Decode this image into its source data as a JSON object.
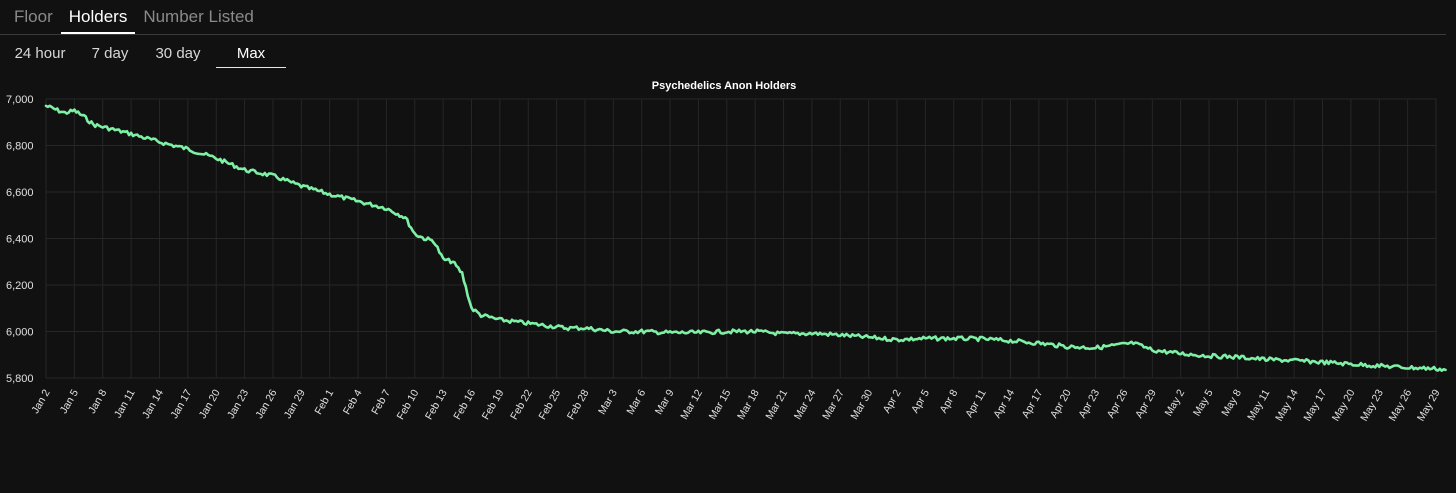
{
  "metric_tabs": [
    {
      "label": "Floor",
      "active": false
    },
    {
      "label": "Holders",
      "active": true
    },
    {
      "label": "Number Listed",
      "active": false
    }
  ],
  "range_tabs": [
    {
      "label": "24 hour",
      "active": false
    },
    {
      "label": "7 day",
      "active": false
    },
    {
      "label": "30 day",
      "active": false
    },
    {
      "label": "Max",
      "active": true
    }
  ],
  "colors": {
    "background": "#111111",
    "line": "#7ef0a6",
    "grid": "#262626",
    "axis_text": "#e0e0e0"
  },
  "chart_data": {
    "type": "line",
    "title": "Psychedelics Anon Holders",
    "xlabel": "",
    "ylabel": "",
    "grid": true,
    "ylim": [
      5800,
      7000
    ],
    "yticks": [
      "5,800",
      "6,000",
      "6,200",
      "6,400",
      "6,600",
      "6,800",
      "7,000"
    ],
    "xticks": [
      "Jan 2",
      "Jan 5",
      "Jan 8",
      "Jan 11",
      "Jan 14",
      "Jan 17",
      "Jan 20",
      "Jan 23",
      "Jan 26",
      "Jan 29",
      "Feb 1",
      "Feb 4",
      "Feb 7",
      "Feb 10",
      "Feb 13",
      "Feb 16",
      "Feb 19",
      "Feb 22",
      "Feb 25",
      "Feb 28",
      "Mar 3",
      "Mar 6",
      "Mar 9",
      "Mar 12",
      "Mar 15",
      "Mar 18",
      "Mar 21",
      "Mar 24",
      "Mar 27",
      "Mar 30",
      "Apr 2",
      "Apr 5",
      "Apr 8",
      "Apr 11",
      "Apr 14",
      "Apr 17",
      "Apr 20",
      "Apr 23",
      "Apr 26",
      "Apr 29",
      "May 2",
      "May 5",
      "May 8",
      "May 11",
      "May 14",
      "May 17",
      "May 20",
      "May 23",
      "May 26",
      "May 29"
    ],
    "series": [
      {
        "name": "",
        "x": [
          "Jan 2",
          "Jan 3",
          "Jan 4",
          "Jan 5",
          "Jan 6",
          "Jan 7",
          "Jan 8",
          "Jan 11",
          "Jan 14",
          "Jan 17",
          "Jan 20",
          "Jan 23",
          "Jan 26",
          "Jan 29",
          "Feb 1",
          "Feb 4",
          "Feb 7",
          "Feb 8",
          "Feb 9",
          "Feb 10",
          "Feb 11",
          "Feb 12",
          "Feb 13",
          "Feb 14",
          "Feb 15",
          "Feb 16",
          "Feb 17",
          "Feb 19",
          "Feb 22",
          "Feb 25",
          "Feb 26",
          "Feb 28",
          "Mar 3",
          "Mar 6",
          "Mar 9",
          "Mar 12",
          "Mar 15",
          "Mar 18",
          "Mar 21",
          "Mar 24",
          "Mar 27",
          "Mar 30",
          "Apr 2",
          "Apr 5",
          "Apr 8",
          "Apr 11",
          "Apr 14",
          "Apr 17",
          "Apr 20",
          "Apr 23",
          "Apr 26",
          "Apr 27",
          "Apr 29",
          "May 2",
          "May 5",
          "May 8",
          "May 11",
          "May 14",
          "May 17",
          "May 20",
          "May 23",
          "May 26",
          "May 29",
          "May 30"
        ],
        "values": [
          6970,
          6955,
          6940,
          6950,
          6925,
          6890,
          6880,
          6850,
          6815,
          6785,
          6745,
          6695,
          6670,
          6625,
          6590,
          6560,
          6530,
          6510,
          6490,
          6420,
          6400,
          6390,
          6310,
          6300,
          6250,
          6100,
          6070,
          6050,
          6035,
          6020,
          6015,
          6015,
          6000,
          6000,
          5995,
          5995,
          6000,
          6000,
          5990,
          5992,
          5985,
          5975,
          5965,
          5970,
          5970,
          5968,
          5960,
          5950,
          5935,
          5930,
          5945,
          5950,
          5920,
          5905,
          5895,
          5890,
          5880,
          5875,
          5868,
          5860,
          5852,
          5845,
          5840,
          5835
        ]
      }
    ]
  }
}
